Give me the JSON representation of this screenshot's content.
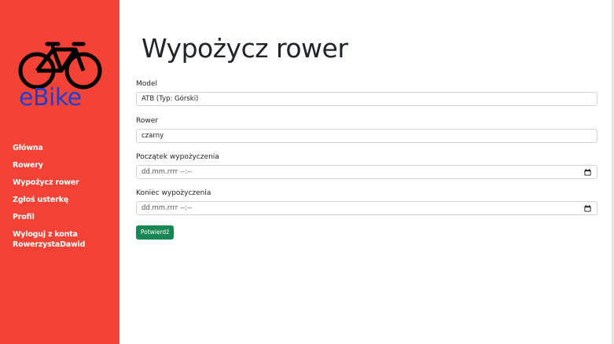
{
  "brand": {
    "logo_text": "eBike",
    "logo_icon": "bicycle-icon"
  },
  "nav": {
    "items": [
      {
        "label": "Główna"
      },
      {
        "label": "Rowery"
      },
      {
        "label": "Wypożycz rower"
      },
      {
        "label": "Zgłoś usterkę"
      },
      {
        "label": "Profil"
      },
      {
        "label": "Wyloguj z konta RowerzystaDawid"
      }
    ]
  },
  "page": {
    "title": "Wypożycz rower"
  },
  "form": {
    "model": {
      "label": "Model",
      "value": "ATB (Typ: Górski)"
    },
    "bike": {
      "label": "Rower",
      "value": "czarny"
    },
    "start": {
      "label": "Początek wypożyczenia",
      "value": "dd.mm.rrrr --:--",
      "icon": "calendar-icon"
    },
    "end": {
      "label": "Koniec wypożyczenia",
      "value": "dd.mm.rrrr --:--",
      "icon": "calendar-icon"
    },
    "submit_label": "Potwierdź"
  },
  "colors": {
    "sidebar": "#f44336",
    "logo_text": "#1e3fd1",
    "submit": "#198754"
  }
}
